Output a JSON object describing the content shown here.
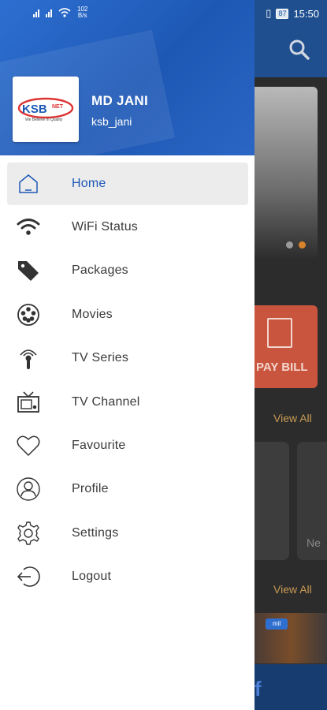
{
  "status_bar": {
    "net_speed_value": "102",
    "net_speed_unit": "B/s",
    "battery": "87",
    "time": "15:50"
  },
  "colors": {
    "primary": "#1e58b5",
    "active_bg": "#ececec",
    "paybill": "#c9553e",
    "view_all": "#c89a54"
  },
  "profile": {
    "brand_name": "KSB NET",
    "brand_tagline": "We Believe in Quality",
    "name": "MD JANI",
    "username": "ksb_jani"
  },
  "menu": [
    {
      "label": "Home",
      "icon": "home-icon",
      "active": true
    },
    {
      "label": "WiFi Status",
      "icon": "wifi-icon",
      "active": false
    },
    {
      "label": "Packages",
      "icon": "tag-icon",
      "active": false
    },
    {
      "label": "Movies",
      "icon": "film-reel-icon",
      "active": false
    },
    {
      "label": "TV Series",
      "icon": "broadcast-icon",
      "active": false
    },
    {
      "label": "TV Channel",
      "icon": "tv-icon",
      "active": false
    },
    {
      "label": "Favourite",
      "icon": "heart-icon",
      "active": false
    },
    {
      "label": "Profile",
      "icon": "user-icon",
      "active": false
    },
    {
      "label": "Settings",
      "icon": "gear-icon",
      "active": false
    },
    {
      "label": "Logout",
      "icon": "logout-icon",
      "active": false
    }
  ],
  "background": {
    "paybill_label": "PAY BILL",
    "view_all_1": "View All",
    "view_all_2": "View All",
    "card_text": "Ne",
    "thumb_tag": "mil"
  }
}
